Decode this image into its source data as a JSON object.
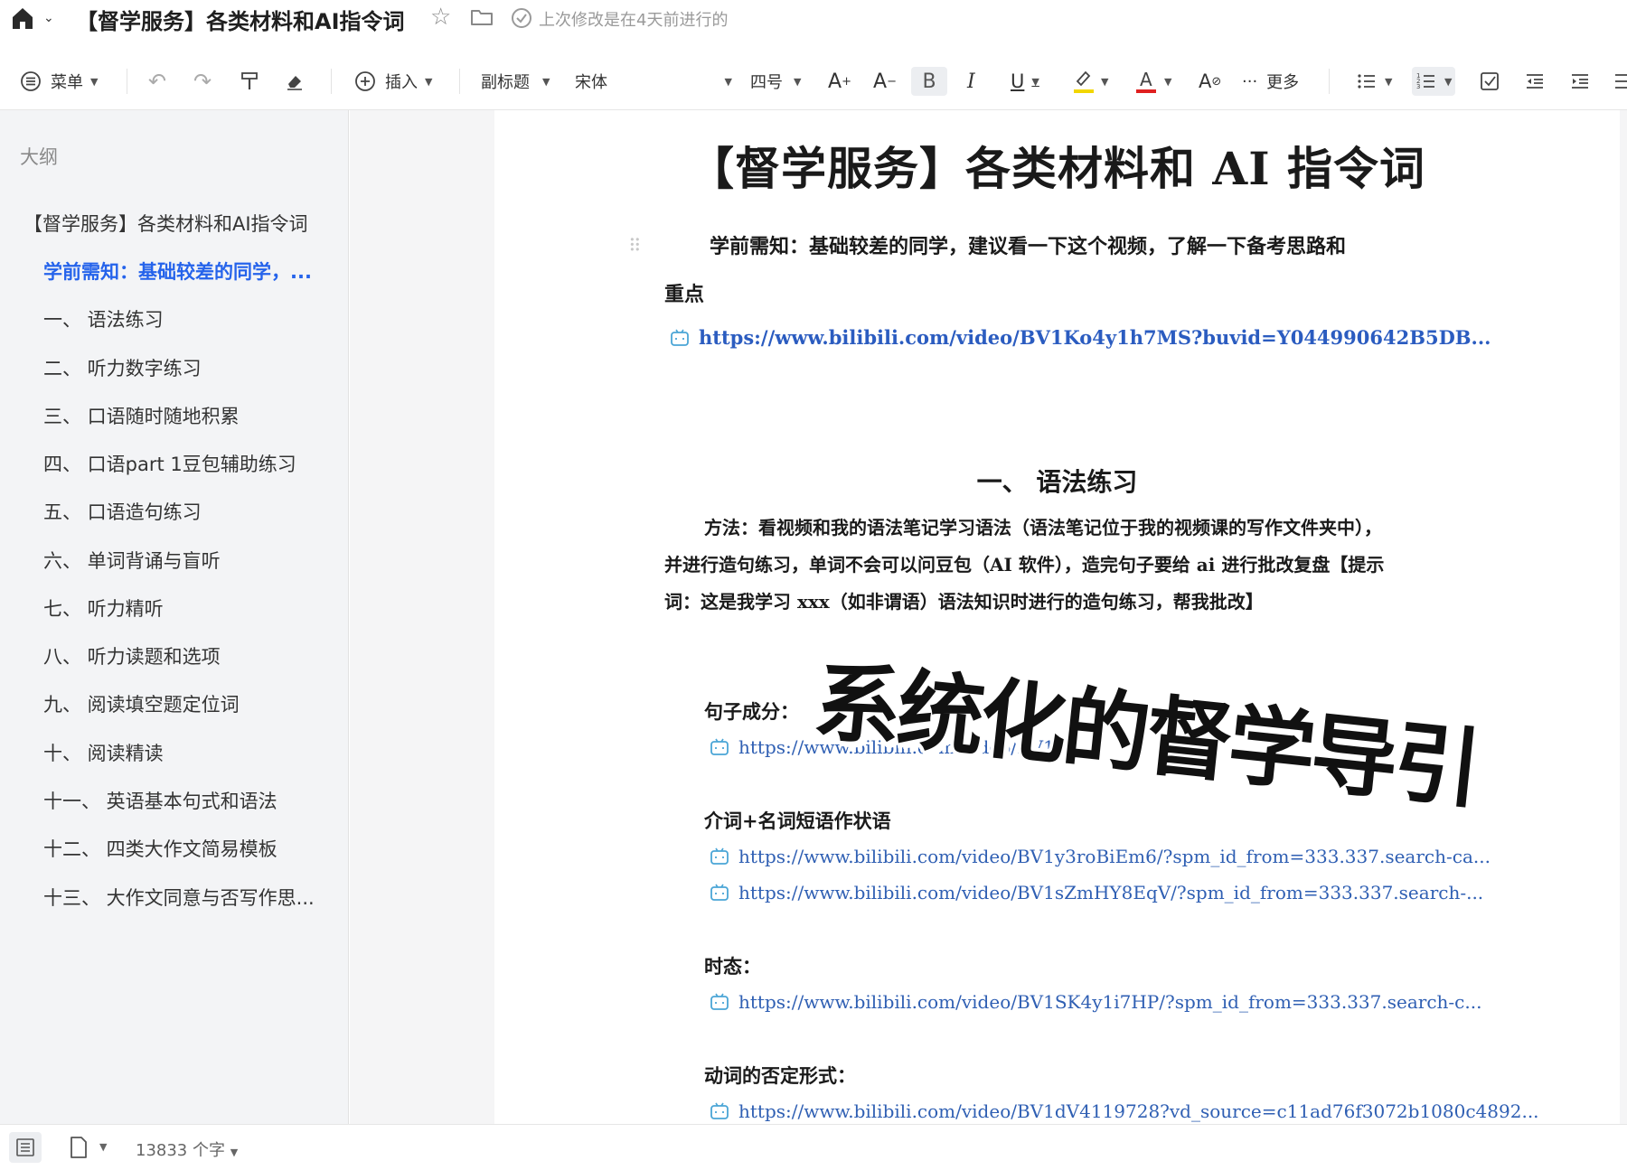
{
  "window": {
    "title": "【督学服务】各类材料和AI指令词",
    "status": "上次修改是在4天前进行的"
  },
  "toolbar": {
    "menu_label": "菜单",
    "insert_label": "插入",
    "style_value": "副标题",
    "font_value": "宋体",
    "size_value": "四号",
    "more_label": "更多",
    "icons": [
      "menu-icon",
      "undo-icon",
      "redo-icon",
      "format-painter-icon",
      "eraser-icon",
      "insert-icon",
      "increase-font-icon",
      "decrease-font-icon",
      "bold-icon",
      "italic-icon",
      "underline-icon",
      "highlight-icon",
      "font-color-icon",
      "clear-format-icon",
      "more-icon",
      "bullet-list-icon",
      "numbered-list-icon",
      "checklist-icon",
      "outdent-icon",
      "indent-icon"
    ],
    "highlight_color": "#f2d600",
    "font_color": "#e02020"
  },
  "outline": {
    "heading": "大纲",
    "items": [
      "【督学服务】各类材料和AI指令词",
      "学前需知：基础较差的同学，...",
      "一、 语法练习",
      "二、 听力数字练习",
      "三、 口语随时随地积累",
      "四、 口语part 1豆包辅助练习",
      "五、 口语造句练习",
      "六、 单词背诵与盲听",
      "七、 听力精听",
      "八、 听力读题和选项",
      "九、 阅读填空题定位词",
      "十、 阅读精读",
      "十一、 英语基本句式和语法",
      "十二、 四类大作文简易模板",
      "十三、 大作文同意与否写作思..."
    ]
  },
  "document": {
    "title": "【督学服务】各类材料和 AI 指令词",
    "intro_line1": "学前需知：基础较差的同学，建议看一下这个视频，了解一下备考思路和",
    "intro_line2": "重点",
    "intro_link": "https://www.bilibili.com/video/BV1Ko4y1h7MS?buvid=Y044990642B5DB...",
    "section1_title": "一、  语法练习",
    "method_line1": "方法：看视频和我的语法笔记学习语法（语法笔记位于我的视频课的写作文件夹中），",
    "method_line2": "并进行造句练习，单词不会可以问豆包（AI 软件），造完句子要给 ai 进行批改复盘【提示",
    "method_line3": "词：这是我学习 xxx（如非谓语）语法知识时进行的造句练习，帮我批改】",
    "sub1": "句子成分：",
    "sub1_link": "https://www.bilibili.com/video/BV1pi4",
    "sub2": "介词+名词短语作状语",
    "sub2_link1": "https://www.bilibili.com/video/BV1y3roBiEm6/?spm_id_from=333.337.search-ca...",
    "sub2_link2": "https://www.bilibili.com/video/BV1sZmHY8EqV/?spm_id_from=333.337.search-...",
    "sub3": "时态：",
    "sub3_link": "https://www.bilibili.com/video/BV1SK4y1i7HP/?spm_id_from=333.337.search-c...",
    "sub4": "动词的否定形式：",
    "sub4_link": "https://www.bilibili.com/video/BV1dV4119728?vd_source=c11ad76f3072b1080c4892..."
  },
  "overlay": {
    "caption": "系统化的督学导引"
  },
  "statusbar": {
    "word_count": "13833 个字"
  }
}
